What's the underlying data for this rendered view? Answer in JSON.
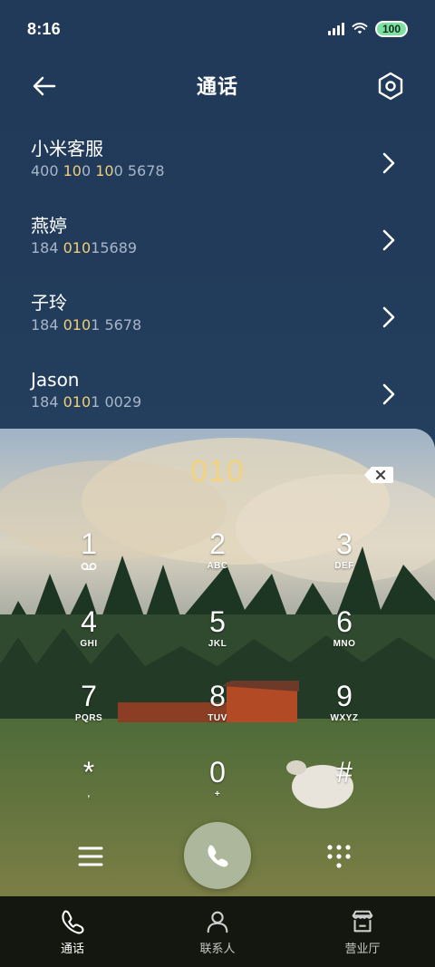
{
  "status": {
    "time": "8:16",
    "battery": "100",
    "colors": {
      "battery": "#7ce09e"
    }
  },
  "header": {
    "title": "通话",
    "icons": {
      "back": "back-arrow-icon",
      "settings": "settings-hexagon-icon"
    }
  },
  "results": [
    {
      "name": "小米客服",
      "number_parts": [
        "400 ",
        "10",
        "0 ",
        "10",
        "0 5678"
      ],
      "highlight_mask": [
        false,
        true,
        false,
        true,
        false
      ]
    },
    {
      "name": "燕婷",
      "number_parts": [
        "184 ",
        "010",
        "15689"
      ],
      "highlight_mask": [
        false,
        true,
        false
      ]
    },
    {
      "name": "子玲",
      "number_parts": [
        "184 ",
        "010",
        "1 5678"
      ],
      "highlight_mask": [
        false,
        true,
        false
      ]
    },
    {
      "name": "Jason",
      "number_parts": [
        "184 ",
        "010",
        "1 0029"
      ],
      "highlight_mask": [
        false,
        true,
        false
      ]
    }
  ],
  "dialer": {
    "display": "010",
    "keys": [
      {
        "digit": "1",
        "letters": ""
      },
      {
        "digit": "2",
        "letters": "ABC"
      },
      {
        "digit": "3",
        "letters": "DEF"
      },
      {
        "digit": "4",
        "letters": "GHI"
      },
      {
        "digit": "5",
        "letters": "JKL"
      },
      {
        "digit": "6",
        "letters": "MNO"
      },
      {
        "digit": "7",
        "letters": "PQRS"
      },
      {
        "digit": "8",
        "letters": "TUV"
      },
      {
        "digit": "9",
        "letters": "WXYZ"
      },
      {
        "digit": "*",
        "letters": ","
      },
      {
        "digit": "0",
        "letters": "+"
      },
      {
        "digit": "#",
        "letters": ""
      }
    ],
    "colors": {
      "display": "#f3d37e",
      "call_button": "#adb79c"
    }
  },
  "tabs": [
    {
      "label": "通话",
      "icon": "phone-icon",
      "active": true
    },
    {
      "label": "联系人",
      "icon": "person-icon",
      "active": false
    },
    {
      "label": "营业厅",
      "icon": "store-icon",
      "active": false
    }
  ]
}
